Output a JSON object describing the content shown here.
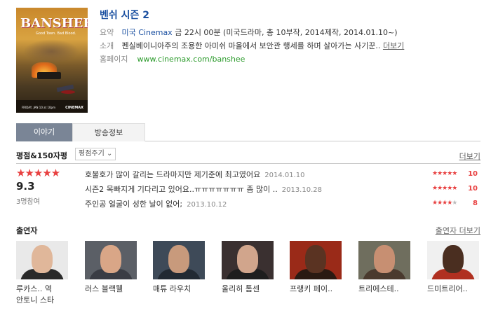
{
  "show": {
    "title": "벤쉬 시즌 2",
    "poster": {
      "title": "BANSHEE",
      "tagline": "Good Town. Bad Blood.",
      "date": "FRIDAY, JAN 10 at 10pm",
      "network": "CINEMAX"
    },
    "summary_label": "요약",
    "summary_country": "미국",
    "summary_channel": "Cinemax",
    "summary_rest": "금 22시 00분 (미국드라마, 총 10부작, 2014제작, 2014.01.10~)",
    "intro_label": "소개",
    "intro_text": "펜실베이니아주의 조용한 아미쉬 마을에서 보안관 행세를 하며 살아가는 사기꾼..",
    "intro_more": "더보기",
    "homepage_label": "홈페이지",
    "homepage_url": "www.cinemax.com/banshee"
  },
  "tabs": [
    {
      "label": "이야기",
      "active": true
    },
    {
      "label": "방송정보",
      "active": false
    }
  ],
  "ratings": {
    "section_title": "평점&150자평",
    "sort_label": "평점주기",
    "more_label": "더보기",
    "average": "9.3",
    "average_stars": 4.5,
    "raters": "3명참여",
    "reviews": [
      {
        "text": "호불호가 많이 갈리는 드라마지만 제기준에 최고였어요",
        "date": "2014.01.10",
        "score": "10",
        "stars": 5
      },
      {
        "text": "시즌2 목빠지게 기다리고 있어요..ㅠㅠㅠㅠㅠㅠㅠ 좀 많이 ..",
        "date": "2013.10.28",
        "score": "10",
        "stars": 5
      },
      {
        "text": "주인공 얼굴이 성한 날이 없어;",
        "date": "2013.10.12",
        "score": "8",
        "stars": 4
      }
    ]
  },
  "cast": {
    "section_title": "출연자",
    "more_label": "출연자 더보기",
    "members": [
      {
        "name": "루카스.. 역",
        "name2": "안토니 스타",
        "bg": "#e9e9e9",
        "face": "#e0b79a",
        "cloth": "#2a2a2a"
      },
      {
        "name": "러스 블랙웰",
        "name2": "",
        "bg": "#5b5f66",
        "face": "#d9a687",
        "cloth": "#3a3c44"
      },
      {
        "name": "매튜 라우치",
        "name2": "",
        "bg": "#3e4a58",
        "face": "#c89a7c",
        "cloth": "#222a33"
      },
      {
        "name": "울리히 톰센",
        "name2": "",
        "bg": "#3a3030",
        "face": "#d1a58c",
        "cloth": "#1e1e1e"
      },
      {
        "name": "프랭키 페이..",
        "name2": "",
        "bg": "#9a2a18",
        "face": "#5a3322",
        "cloth": "#2a1a12"
      },
      {
        "name": "트리에스테..",
        "name2": "",
        "bg": "#6f6e5e",
        "face": "#c78f72",
        "cloth": "#4a3a2e"
      },
      {
        "name": "드미트리어..",
        "name2": "",
        "bg": "#f0f0f0",
        "face": "#4a2e20",
        "cloth": "#b03020"
      }
    ]
  },
  "colors": {
    "accent": "#1a4fa0",
    "star": "#e84040",
    "tab_active": "#7a8596",
    "url": "#2a9a2a"
  }
}
